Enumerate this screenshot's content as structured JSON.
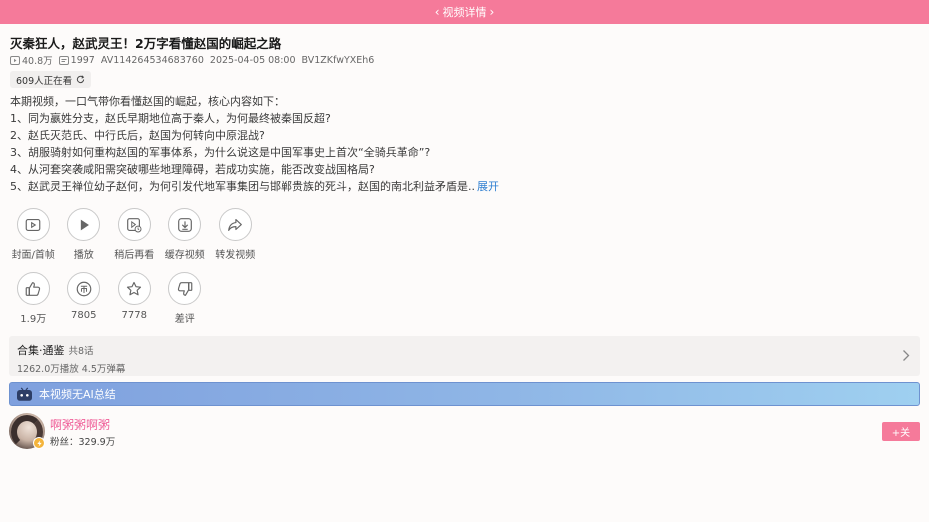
{
  "header": {
    "title": "视频详情",
    "back_glyph": "‹",
    "forward_glyph": "›"
  },
  "video": {
    "title": "灭秦狂人，赵武灵王！2万字看懂赵国的崛起之路",
    "views": "40.8万",
    "danmaku": "1997",
    "av": "AV114264534683760",
    "datetime": "2025-04-05 08:00",
    "bv": "BV1ZKfwYXEh6",
    "watching": "609人正在看",
    "description": [
      "本期视频，一口气带你看懂赵国的崛起，核心内容如下：",
      "1、同为嬴姓分支，赵氏早期地位高于秦人，为何最终被秦国反超?",
      "2、赵氏灭范氏、中行氏后，赵国为何转向中原混战?",
      "3、胡服骑射如何重构赵国的军事体系，为什么说这是中国军事史上首次“全骑兵革命”?",
      "4、从河套突袭咸阳需突破哪些地理障碍，若成功实施，能否改变战国格局?",
      "5、赵武灵王禅位幼子赵何，为何引发代地军事集团与邯郸贵族的死斗，赵国的南北利益矛盾是.."
    ],
    "expand_label": "展开"
  },
  "actions_row1": [
    {
      "key": "cover",
      "label": "封面/首帧",
      "icon": "cover-icon"
    },
    {
      "key": "play",
      "label": "播放",
      "icon": "play-icon"
    },
    {
      "key": "later",
      "label": "稍后再看",
      "icon": "watch-later-icon"
    },
    {
      "key": "cache",
      "label": "缓存视频",
      "icon": "download-icon"
    },
    {
      "key": "share",
      "label": "转发视频",
      "icon": "share-icon"
    }
  ],
  "actions_row2": [
    {
      "key": "like",
      "label": "1.9万",
      "icon": "thumbs-up-icon"
    },
    {
      "key": "coin",
      "label": "7805",
      "icon": "coin-icon"
    },
    {
      "key": "fav",
      "label": "7778",
      "icon": "star-icon"
    },
    {
      "key": "dislike",
      "label": "差评",
      "icon": "thumbs-down-icon"
    }
  ],
  "collection": {
    "name": "合集·通鉴",
    "count": "共8话",
    "stats": "1262.0万播放  4.5万弹幕"
  },
  "ai_summary": {
    "text": "本视频无AI总结",
    "icon": "tv-robot-icon"
  },
  "uploader": {
    "name": "啊粥粥啊粥",
    "fans": "粉丝：329.9万",
    "follow_label": "+关"
  },
  "colors": {
    "accent": "#f57a9a",
    "uploader_name": "#f0629a",
    "link": "#2f7fd1",
    "ai_bar": "#8fb6e6"
  }
}
